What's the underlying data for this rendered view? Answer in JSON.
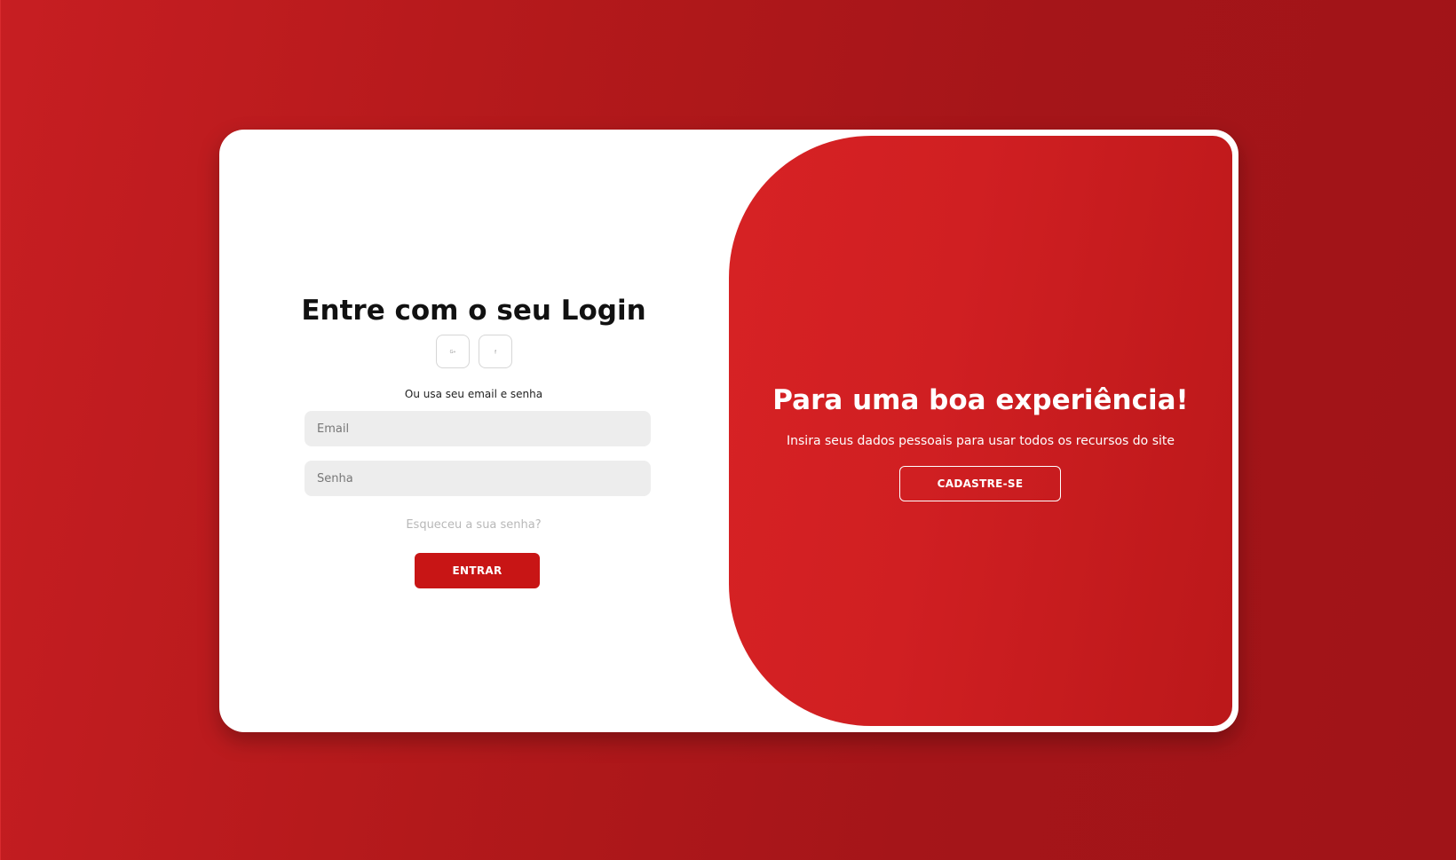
{
  "login": {
    "title": "Entre com o seu Login",
    "social": [
      {
        "icon": "google-plus-icon",
        "label": "G+"
      },
      {
        "icon": "facebook-icon",
        "label": "f"
      }
    ],
    "separator_text": "Ou usa seu email e senha",
    "email_placeholder": "Email",
    "email_value": "",
    "password_placeholder": "Senha",
    "password_value": "",
    "forgot_password": "Esqueceu a sua senha?",
    "submit_label": "ENTRAR"
  },
  "welcome": {
    "title": "Para uma boa experiência!",
    "text": "Insira seus dados pessoais para usar todos os recursos do site",
    "signup_label": "CADASTRE-SE"
  },
  "colors": {
    "background": "#b3191b",
    "accent": "#c81515",
    "panel": "#d01f22",
    "card": "#ffffff"
  }
}
